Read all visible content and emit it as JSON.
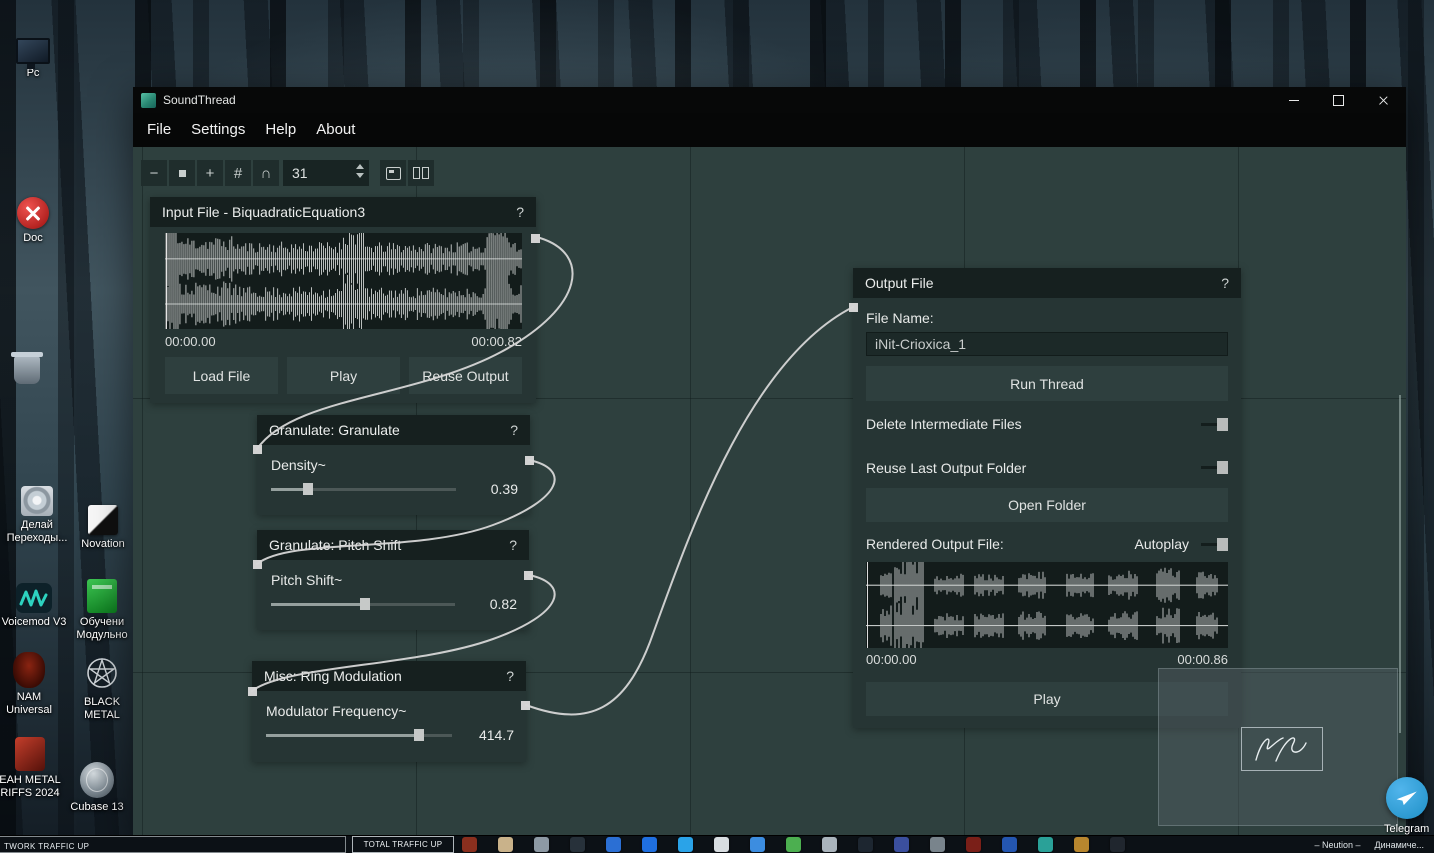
{
  "desktop": {
    "icons": [
      {
        "id": "pc",
        "label": "Pc"
      },
      {
        "id": "doc",
        "label": "Doc"
      },
      {
        "id": "recycle-bin",
        "label": ""
      },
      {
        "id": "perekhody",
        "label": "Делай Переходы..."
      },
      {
        "id": "novation",
        "label": "Novation"
      },
      {
        "id": "voicemod",
        "label": "Voicemod V3"
      },
      {
        "id": "obuchenie",
        "label": "Обучени Модульно"
      },
      {
        "id": "nam-universal",
        "label": "NAM Universal"
      },
      {
        "id": "black-metal",
        "label": "BLACK METAL"
      },
      {
        "id": "eah-metal",
        "label": "EAH METAL RIFFS 2024"
      },
      {
        "id": "cubase",
        "label": "Cubase 13"
      }
    ]
  },
  "window": {
    "title": "SoundThread",
    "menu": [
      "File",
      "Settings",
      "Help",
      "About"
    ],
    "toolbar": {
      "zoom_out": "−",
      "zoom_in": "+",
      "grid": "#",
      "monitor": "∩",
      "value": "31"
    }
  },
  "nodes": {
    "input": {
      "title": "Input File - BiquadraticEquation3",
      "help": "?",
      "time_start": "00:00.00",
      "time_end": "00:00.82",
      "load_label": "Load File",
      "play_label": "Play",
      "reuse_label": "Reuse Output"
    },
    "granulate": {
      "title": "Granulate: Granulate",
      "help": "?",
      "param": "Density~",
      "value": "0.39",
      "slider_pct": 20
    },
    "pitch": {
      "title": "Granulate: Pitch Shift",
      "help": "?",
      "param": "Pitch Shift~",
      "value": "0.82",
      "slider_pct": 51
    },
    "ring": {
      "title": "Misc: Ring Modulation",
      "help": "?",
      "param": "Modulator Frequency~",
      "value": "414.7",
      "slider_pct": 82
    },
    "output": {
      "title": "Output File",
      "help": "?",
      "file_name_label": "File Name:",
      "file_name": "iNit-Crioxica_1",
      "run_label": "Run Thread",
      "delete_toggle_label": "Delete Intermediate Files",
      "reuse_toggle_label": "Reuse Last Output Folder",
      "open_folder_label": "Open Folder",
      "rendered_label": "Rendered Output File:",
      "autoplay_label": "Autoplay",
      "time_start": "00:00.00",
      "time_end": "00:00.86",
      "play_label": "Play"
    }
  },
  "taskbar": {
    "net1": "TWORK TRAFFIC UP",
    "net2": "TOTAL TRAFFIC UP",
    "tray1": "– Neution –",
    "tray2": "Динамиче...",
    "telegram_label": "Telegram",
    "icon_colors": [
      "#8a2f1e",
      "#c9b28a",
      "#8d99a4",
      "#27313a",
      "#2b6fd4",
      "#1f6fe0",
      "#2aa3e8",
      "#d8dde1",
      "#3c8de0",
      "#4caf50",
      "#aab4bc",
      "#1d2630",
      "#3b4f9e",
      "#79848c",
      "#7a1f18",
      "#2456b0",
      "#2aa198",
      "#b8862e",
      "#20262e"
    ]
  }
}
